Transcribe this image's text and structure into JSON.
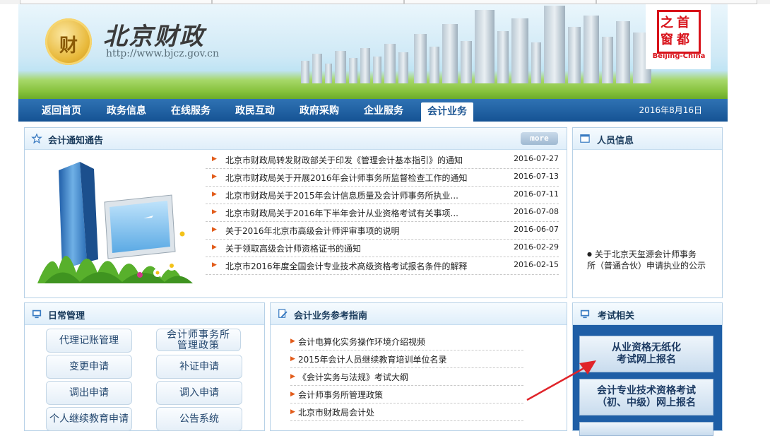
{
  "site": {
    "title": "北京财政",
    "url": "http://www.bjcz.gov.cn",
    "seal_char": "财",
    "partner_logo_chars": [
      "首",
      "都",
      "之",
      "窗"
    ],
    "partner_logo_en": "Beijing-China"
  },
  "nav": {
    "items": [
      "返回首页",
      "政务信息",
      "在线服务",
      "政民互动",
      "政府采购",
      "企业服务",
      "会计业务"
    ],
    "active": "会计业务",
    "date": "2016年8月16日"
  },
  "notices": {
    "title": "会计通知通告",
    "more_label": "more",
    "items": [
      {
        "text": "北京市财政局转发财政部关于印发《管理会计基本指引》的通知",
        "date": "2016-07-27"
      },
      {
        "text": "北京市财政局关于开展2016年会计师事务所监督检查工作的通知",
        "date": "2016-07-13"
      },
      {
        "text": "北京市财政局关于2015年会计信息质量及会计师事务所执业...",
        "date": "2016-07-11"
      },
      {
        "text": "北京市财政局关于2016年下半年会计从业资格考试有关事项...",
        "date": "2016-07-08"
      },
      {
        "text": "关于2016年北京市高级会计师评审事项的说明",
        "date": "2016-06-07"
      },
      {
        "text": "关于领取高级会计师资格证书的通知",
        "date": "2016-02-29"
      },
      {
        "text": "北京市2016年度全国会计专业技术高级资格考试报名条件的解释",
        "date": "2016-02-15"
      }
    ]
  },
  "personnel": {
    "title": "人员信息",
    "item_line1": "关于北京天玺源会计师事务",
    "item_line2": "所（普通合伙）申请执业的公示"
  },
  "daily": {
    "title": "日常管理",
    "buttons": [
      {
        "label": "代理记账管理",
        "two_line": false
      },
      {
        "label_line1": "会计师事务所",
        "label_line2": "管理政策",
        "two_line": true
      },
      {
        "label": "变更申请",
        "two_line": false
      },
      {
        "label": "补证申请",
        "two_line": false
      },
      {
        "label": "调出申请",
        "two_line": false
      },
      {
        "label": "调入申请",
        "two_line": false
      },
      {
        "label": "个人继续教育申请",
        "two_line": false
      },
      {
        "label": "公告系统",
        "two_line": false
      }
    ]
  },
  "guide": {
    "title": "会计业务参考指南",
    "items": [
      "会计电算化实务操作环境介绍视频",
      "2015年会计人员继续教育培训单位名录",
      "《会计实务与法规》考试大纲",
      "会计师事务所管理政策",
      "北京市财政局会计处"
    ]
  },
  "exam": {
    "title": "考试相关",
    "buttons": [
      {
        "line1": "从业资格无纸化",
        "line2": "考试网上报名"
      },
      {
        "line1": "会计专业技术资格考试",
        "line2": "（初、中级）网上报名"
      }
    ]
  },
  "colors": {
    "nav_blue": "#1c5592",
    "arrow_red": "#e0242a",
    "bullet_orange": "#e25b1a"
  }
}
